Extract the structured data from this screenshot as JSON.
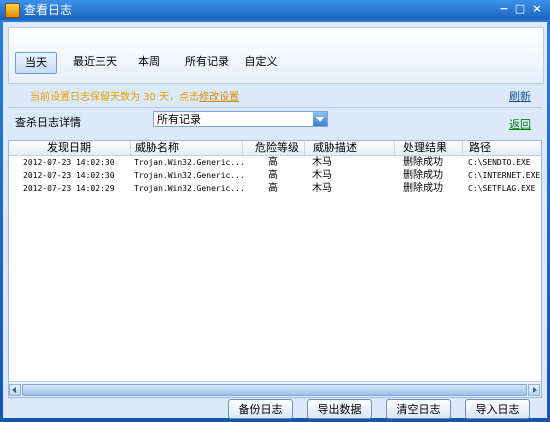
{
  "window": {
    "title": "查看日志",
    "minimize": "−",
    "maximize": "□",
    "close": "×"
  },
  "tabs": [
    {
      "label": "当天",
      "active": true
    },
    {
      "label": "最近三天",
      "active": false
    },
    {
      "label": "本周",
      "active": false
    },
    {
      "label": "所有记录",
      "active": false
    },
    {
      "label": "自定义",
      "active": false
    }
  ],
  "notice": {
    "text": "当前设置日志保留天数为 30 天，点击",
    "link": "修改设置"
  },
  "refresh_label": "刷新",
  "filter": {
    "label": "查杀日志详情",
    "selected": "所有记录"
  },
  "back_label": "返回",
  "table": {
    "columns": [
      "发现日期",
      "威胁名称",
      "危险等级",
      "威胁描述",
      "处理结果",
      "路径"
    ],
    "rows": [
      [
        "2012-07-23 14:02:30",
        "Trojan.Win32.Generic...",
        "高",
        "木马",
        "删除成功",
        "C:\\SENDTO.EXE"
      ],
      [
        "2012-07-23 14:02:30",
        "Trojan.Win32.Generic...",
        "高",
        "木马",
        "删除成功",
        "C:\\INTERNET.EXE"
      ],
      [
        "2012-07-23 14:02:29",
        "Trojan.Win32.Generic...",
        "高",
        "木马",
        "删除成功",
        "C:\\SETFLAG.EXE"
      ]
    ]
  },
  "buttons": {
    "backup": "备份日志",
    "export": "导出数据",
    "clear": "清空日志",
    "import": "导入日志"
  },
  "colors": {
    "titlebar": "#1a62bf",
    "notice": "#e8a000",
    "back_link": "#0a7a10"
  }
}
